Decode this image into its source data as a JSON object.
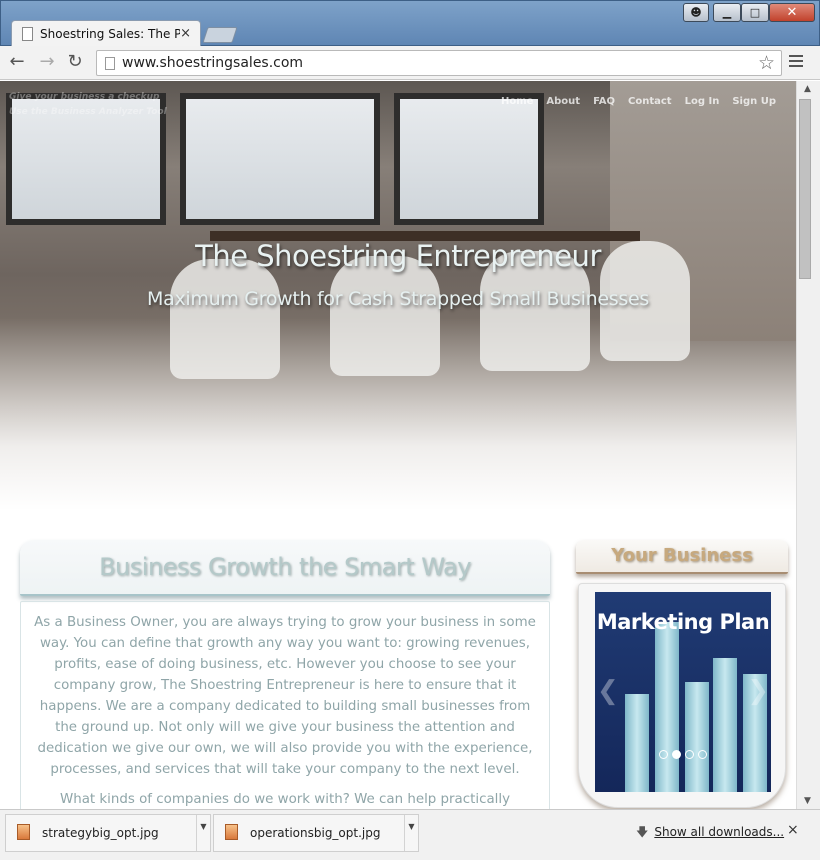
{
  "browser": {
    "tab_title": "Shoestring Sales: The Perf",
    "tab_close": "×",
    "url": "www.shoestringsales.com"
  },
  "window_controls": {
    "minimize": "▁",
    "maximize": "□",
    "close": "✕"
  },
  "site": {
    "promo_line1": "Give your business a checkup",
    "promo_line2": "Use the Business Analyzer Tool",
    "nav": [
      "Home",
      "About",
      "FAQ",
      "Contact",
      "Log In",
      "Sign Up"
    ],
    "hero_title": "The Shoestring Entrepreneur",
    "hero_subtitle": "Maximum Growth for Cash Strapped Small Businesses",
    "section_title": "Business Growth the Smart Way",
    "paragraph1": "As a Business Owner, you are always trying to grow your business in some way. You can define that growth any way you want to: growing revenues, profits, ease of doing business, etc. However you choose to see your company grow, The Shoestring Entrepreneur is here to ensure that it happens. We are a company dedicated to building small businesses from the ground up. Not only will we give your business the attention and dedication we give our own, we will also provide you with the experience, processes, and services that will take your company to the next level.",
    "paragraph2": "What kinds of companies do we work with? We can help practically",
    "sidebar_title": "Your Business",
    "slide_title": "Marketing Plan",
    "slide_count": 4,
    "slide_active": 2
  },
  "downloads": {
    "items": [
      {
        "name": "strategybig_opt.jpg"
      },
      {
        "name": "operationsbig_opt.jpg"
      }
    ],
    "show_all": "Show all downloads...",
    "close": "×"
  },
  "icons": {
    "back": "back-arrow-icon",
    "forward": "forward-arrow-icon",
    "reload": "reload-icon",
    "bookmark": "star-icon",
    "menu": "menu-icon"
  }
}
